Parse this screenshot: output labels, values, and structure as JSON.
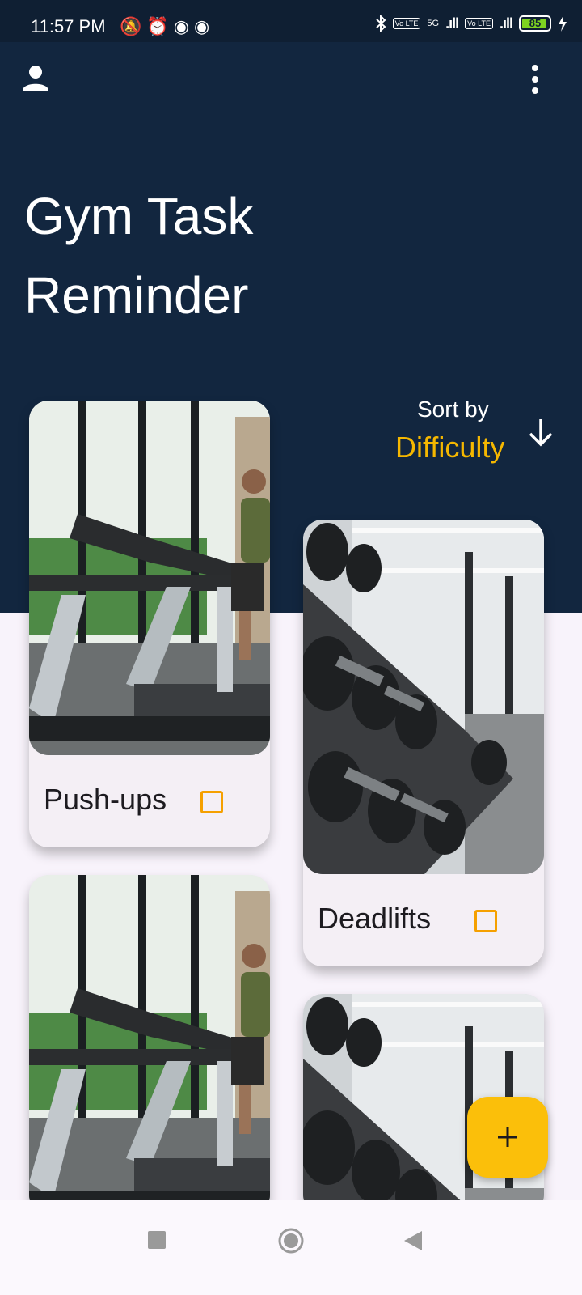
{
  "status_bar": {
    "time": "11:57 PM",
    "left_icons": "🔕⏰◉◉",
    "network_label": "5G",
    "volte": "Vo LTE",
    "signal_bars": ".ıll",
    "battery": "85"
  },
  "app_bar": {
    "title": "Gym Task Reminder",
    "account_icon": "account-icon",
    "menu_icon": "more-vert-icon"
  },
  "sort": {
    "label": "Sort by",
    "value": "Difficulty",
    "icon": "arrow-down-icon"
  },
  "tasks": [
    {
      "name": "Push-ups",
      "done": false,
      "image": "treadmill-photo"
    },
    {
      "name": "Deadlifts",
      "done": false,
      "image": "dumbbell-rack-photo"
    },
    {
      "name": "",
      "done": false,
      "image": "treadmill-photo"
    },
    {
      "name": "",
      "done": false,
      "image": "dumbbell-rack-photo"
    }
  ],
  "fab": {
    "icon": "plus-icon"
  },
  "colors": {
    "header": "#12263f",
    "accent": "#f5b700",
    "fab": "#fbbf0a",
    "background": "#f8f3fb"
  },
  "nav_bar": {
    "buttons": [
      "recents-icon",
      "home-icon",
      "back-icon"
    ]
  }
}
